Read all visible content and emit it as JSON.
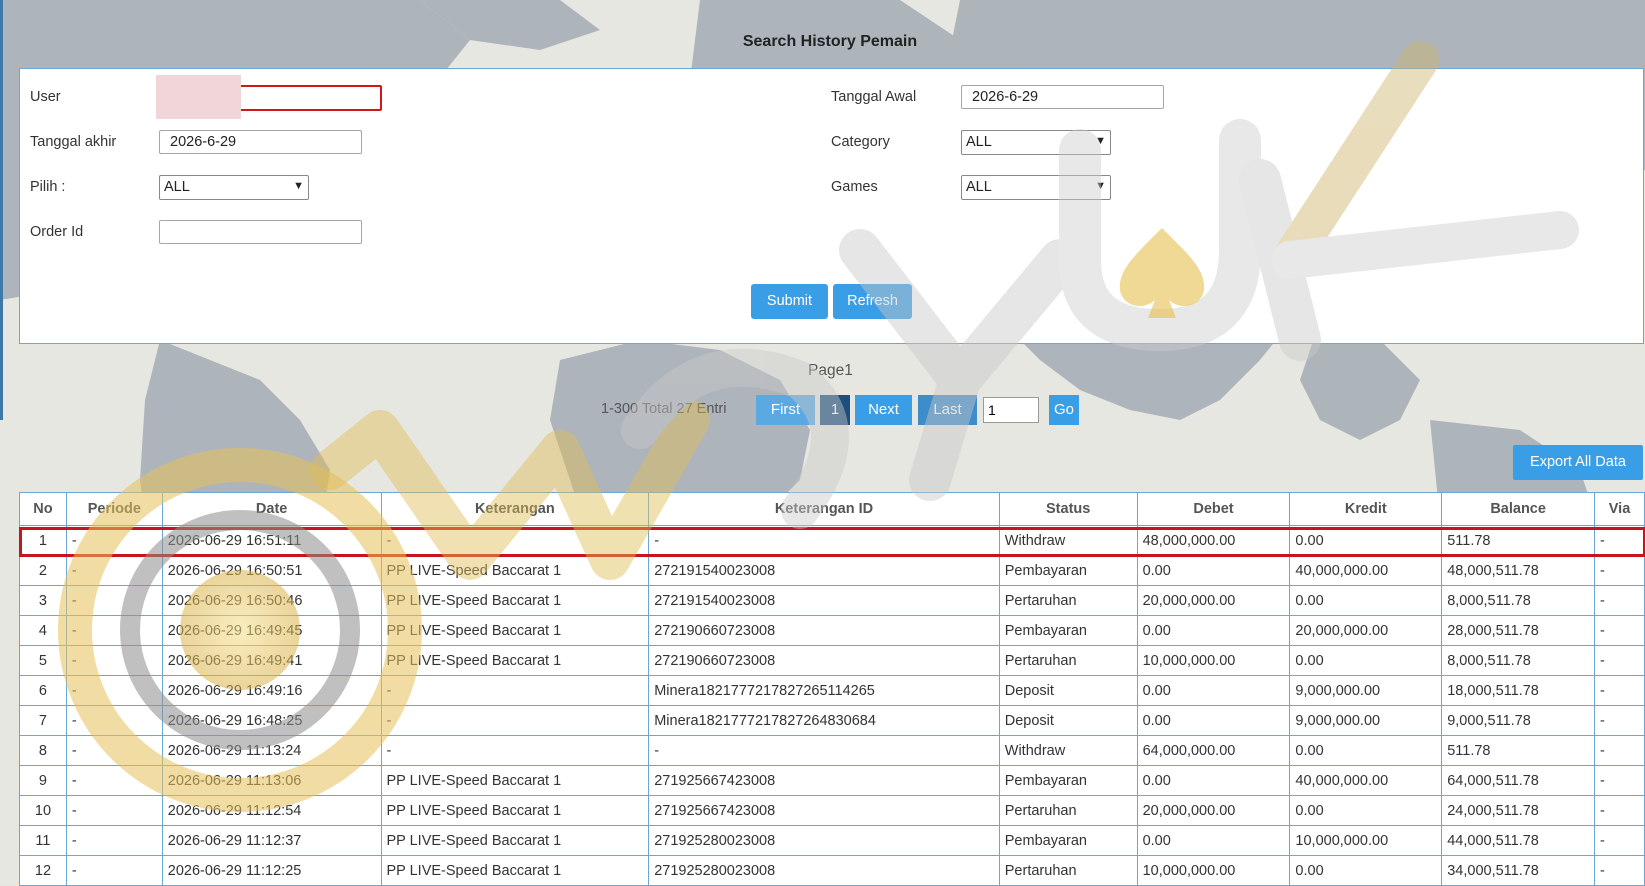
{
  "page_title": "Search History Pemain",
  "form": {
    "user_label": "User",
    "user_value": "",
    "tanggal_awal_label": "Tanggal Awal",
    "tanggal_awal_value": "2026-6-29",
    "tanggal_akhir_label": "Tanggal akhir",
    "tanggal_akhir_value": "2026-6-29",
    "category_label": "Category",
    "category_value": "ALL",
    "pilih_label": "Pilih  :",
    "pilih_value": "ALL",
    "games_label": "Games",
    "games_value": "ALL",
    "order_id_label": "Order Id",
    "order_id_value": "",
    "submit_label": "Submit",
    "refresh_label": "Refresh"
  },
  "pagination": {
    "page_label": "Page1",
    "total_text": "1-300 Total 27 Entri",
    "first": "First",
    "current": "1",
    "next": "Next",
    "last": "Last",
    "goto_value": "1",
    "go": "Go"
  },
  "export_label": "Export All Data",
  "table": {
    "headers": [
      "No",
      "Periode",
      "Date",
      "Keterangan",
      "Keterangan ID",
      "Status",
      "Debet",
      "Kredit",
      "Balance",
      "Via"
    ],
    "rows": [
      [
        "1",
        "-",
        "2026-06-29 16:51:11",
        "-",
        "-",
        "Withdraw",
        "48,000,000.00",
        "0.00",
        "511.78",
        "-"
      ],
      [
        "2",
        "-",
        "2026-06-29 16:50:51",
        "PP LIVE-Speed Baccarat 1",
        "272191540023008",
        "Pembayaran",
        "0.00",
        "40,000,000.00",
        "48,000,511.78",
        "-"
      ],
      [
        "3",
        "-",
        "2026-06-29 16:50:46",
        "PP LIVE-Speed Baccarat 1",
        "272191540023008",
        "Pertaruhan",
        "20,000,000.00",
        "0.00",
        "8,000,511.78",
        "-"
      ],
      [
        "4",
        "-",
        "2026-06-29 16:49:45",
        "PP LIVE-Speed Baccarat 1",
        "272190660723008",
        "Pembayaran",
        "0.00",
        "20,000,000.00",
        "28,000,511.78",
        "-"
      ],
      [
        "5",
        "-",
        "2026-06-29 16:49:41",
        "PP LIVE-Speed Baccarat 1",
        "272190660723008",
        "Pertaruhan",
        "10,000,000.00",
        "0.00",
        "8,000,511.78",
        "-"
      ],
      [
        "6",
        "-",
        "2026-06-29 16:49:16",
        "-",
        "Minera182177721782726511426​5",
        "Deposit",
        "0.00",
        "9,000,000.00",
        "18,000,511.78",
        "-"
      ],
      [
        "7",
        "-",
        "2026-06-29 16:48:25",
        "-",
        "Minera182177721782726483068​4",
        "Deposit",
        "0.00",
        "9,000,000.00",
        "9,000,511.78",
        "-"
      ],
      [
        "8",
        "-",
        "2026-06-29 11:13:24",
        "-",
        "-",
        "Withdraw",
        "64,000,000.00",
        "0.00",
        "511.78",
        "-"
      ],
      [
        "9",
        "-",
        "2026-06-29 11:13:06",
        "PP LIVE-Speed Baccarat 1",
        "271925667423008",
        "Pembayaran",
        "0.00",
        "40,000,000.00",
        "64,000,511.78",
        "-"
      ],
      [
        "10",
        "-",
        "2026-06-29 11:12:54",
        "PP LIVE-Speed Baccarat 1",
        "271925667423008",
        "Pertaruhan",
        "20,000,000.00",
        "0.00",
        "24,000,511.78",
        "-"
      ],
      [
        "11",
        "-",
        "2026-06-29 11:12:37",
        "PP LIVE-Speed Baccarat 1",
        "271925280023008",
        "Pembayaran",
        "0.00",
        "10,000,000.00",
        "44,000,511.78",
        "-"
      ],
      [
        "12",
        "-",
        "2026-06-29 11:12:25",
        "PP LIVE-Speed Baccarat 1",
        "271925280023008",
        "Pertaruhan",
        "10,000,000.00",
        "0.00",
        "34,000,511.78",
        "-"
      ]
    ]
  },
  "colors": {
    "accent": "#3a9ee6",
    "link": "#2f86c6",
    "withdraw_red": "#d01818",
    "deposit_green": "#2a9a2a",
    "highlight_border": "#c8141e"
  },
  "watermark_text": "WD YUK"
}
